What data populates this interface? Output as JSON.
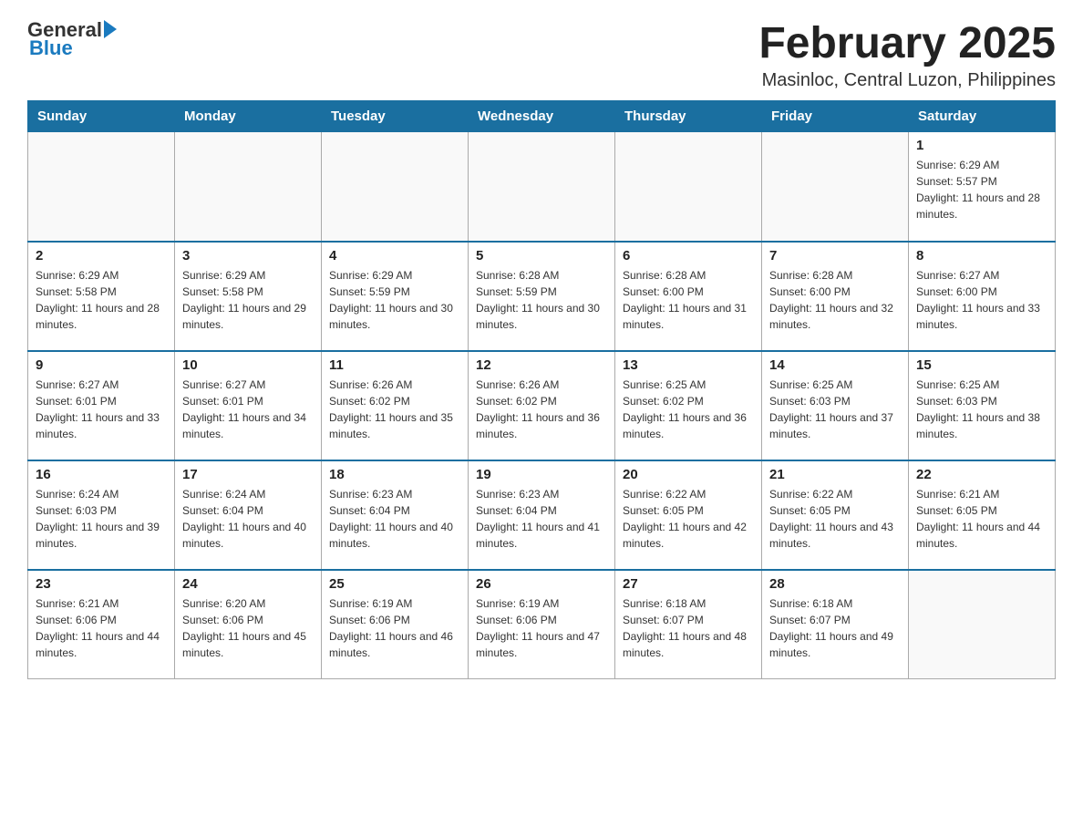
{
  "header": {
    "logo_text_main": "General",
    "logo_text_blue": "Blue",
    "month_title": "February 2025",
    "location": "Masinloc, Central Luzon, Philippines"
  },
  "days_of_week": [
    "Sunday",
    "Monday",
    "Tuesday",
    "Wednesday",
    "Thursday",
    "Friday",
    "Saturday"
  ],
  "weeks": [
    [
      {
        "date": "",
        "info": ""
      },
      {
        "date": "",
        "info": ""
      },
      {
        "date": "",
        "info": ""
      },
      {
        "date": "",
        "info": ""
      },
      {
        "date": "",
        "info": ""
      },
      {
        "date": "",
        "info": ""
      },
      {
        "date": "1",
        "info": "Sunrise: 6:29 AM\nSunset: 5:57 PM\nDaylight: 11 hours and 28 minutes."
      }
    ],
    [
      {
        "date": "2",
        "info": "Sunrise: 6:29 AM\nSunset: 5:58 PM\nDaylight: 11 hours and 28 minutes."
      },
      {
        "date": "3",
        "info": "Sunrise: 6:29 AM\nSunset: 5:58 PM\nDaylight: 11 hours and 29 minutes."
      },
      {
        "date": "4",
        "info": "Sunrise: 6:29 AM\nSunset: 5:59 PM\nDaylight: 11 hours and 30 minutes."
      },
      {
        "date": "5",
        "info": "Sunrise: 6:28 AM\nSunset: 5:59 PM\nDaylight: 11 hours and 30 minutes."
      },
      {
        "date": "6",
        "info": "Sunrise: 6:28 AM\nSunset: 6:00 PM\nDaylight: 11 hours and 31 minutes."
      },
      {
        "date": "7",
        "info": "Sunrise: 6:28 AM\nSunset: 6:00 PM\nDaylight: 11 hours and 32 minutes."
      },
      {
        "date": "8",
        "info": "Sunrise: 6:27 AM\nSunset: 6:00 PM\nDaylight: 11 hours and 33 minutes."
      }
    ],
    [
      {
        "date": "9",
        "info": "Sunrise: 6:27 AM\nSunset: 6:01 PM\nDaylight: 11 hours and 33 minutes."
      },
      {
        "date": "10",
        "info": "Sunrise: 6:27 AM\nSunset: 6:01 PM\nDaylight: 11 hours and 34 minutes."
      },
      {
        "date": "11",
        "info": "Sunrise: 6:26 AM\nSunset: 6:02 PM\nDaylight: 11 hours and 35 minutes."
      },
      {
        "date": "12",
        "info": "Sunrise: 6:26 AM\nSunset: 6:02 PM\nDaylight: 11 hours and 36 minutes."
      },
      {
        "date": "13",
        "info": "Sunrise: 6:25 AM\nSunset: 6:02 PM\nDaylight: 11 hours and 36 minutes."
      },
      {
        "date": "14",
        "info": "Sunrise: 6:25 AM\nSunset: 6:03 PM\nDaylight: 11 hours and 37 minutes."
      },
      {
        "date": "15",
        "info": "Sunrise: 6:25 AM\nSunset: 6:03 PM\nDaylight: 11 hours and 38 minutes."
      }
    ],
    [
      {
        "date": "16",
        "info": "Sunrise: 6:24 AM\nSunset: 6:03 PM\nDaylight: 11 hours and 39 minutes."
      },
      {
        "date": "17",
        "info": "Sunrise: 6:24 AM\nSunset: 6:04 PM\nDaylight: 11 hours and 40 minutes."
      },
      {
        "date": "18",
        "info": "Sunrise: 6:23 AM\nSunset: 6:04 PM\nDaylight: 11 hours and 40 minutes."
      },
      {
        "date": "19",
        "info": "Sunrise: 6:23 AM\nSunset: 6:04 PM\nDaylight: 11 hours and 41 minutes."
      },
      {
        "date": "20",
        "info": "Sunrise: 6:22 AM\nSunset: 6:05 PM\nDaylight: 11 hours and 42 minutes."
      },
      {
        "date": "21",
        "info": "Sunrise: 6:22 AM\nSunset: 6:05 PM\nDaylight: 11 hours and 43 minutes."
      },
      {
        "date": "22",
        "info": "Sunrise: 6:21 AM\nSunset: 6:05 PM\nDaylight: 11 hours and 44 minutes."
      }
    ],
    [
      {
        "date": "23",
        "info": "Sunrise: 6:21 AM\nSunset: 6:06 PM\nDaylight: 11 hours and 44 minutes."
      },
      {
        "date": "24",
        "info": "Sunrise: 6:20 AM\nSunset: 6:06 PM\nDaylight: 11 hours and 45 minutes."
      },
      {
        "date": "25",
        "info": "Sunrise: 6:19 AM\nSunset: 6:06 PM\nDaylight: 11 hours and 46 minutes."
      },
      {
        "date": "26",
        "info": "Sunrise: 6:19 AM\nSunset: 6:06 PM\nDaylight: 11 hours and 47 minutes."
      },
      {
        "date": "27",
        "info": "Sunrise: 6:18 AM\nSunset: 6:07 PM\nDaylight: 11 hours and 48 minutes."
      },
      {
        "date": "28",
        "info": "Sunrise: 6:18 AM\nSunset: 6:07 PM\nDaylight: 11 hours and 49 minutes."
      },
      {
        "date": "",
        "info": ""
      }
    ]
  ]
}
